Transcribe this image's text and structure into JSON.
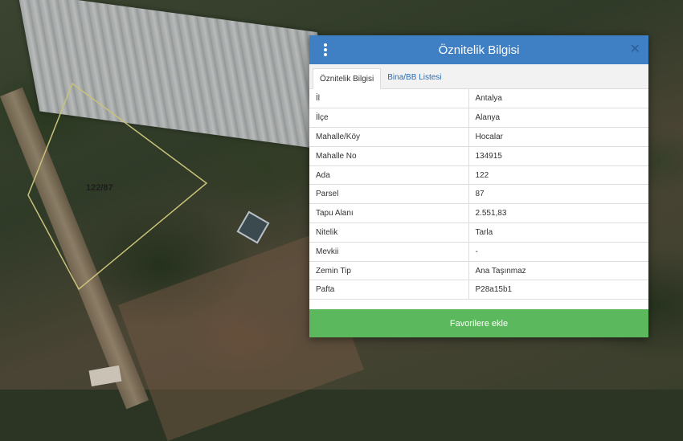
{
  "map": {
    "parcel_label": "122/87"
  },
  "dialog": {
    "title": "Öznitelik Bilgisi",
    "close_symbol": "✕",
    "tabs": [
      {
        "label": "Öznitelik Bilgisi",
        "active": true
      },
      {
        "label": "Bina/BB Listesi",
        "active": false
      }
    ],
    "rows": [
      {
        "key": "İl",
        "value": "Antalya"
      },
      {
        "key": "İlçe",
        "value": "Alanya"
      },
      {
        "key": "Mahalle/Köy",
        "value": "Hocalar"
      },
      {
        "key": "Mahalle No",
        "value": "134915"
      },
      {
        "key": "Ada",
        "value": "122"
      },
      {
        "key": "Parsel",
        "value": "87"
      },
      {
        "key": "Tapu Alanı",
        "value": "2.551,83"
      },
      {
        "key": "Nitelik",
        "value": "Tarla"
      },
      {
        "key": "Mevkii",
        "value": "-"
      },
      {
        "key": "Zemin Tip",
        "value": "Ana Taşınmaz"
      },
      {
        "key": "Pafta",
        "value": "P28a15b1"
      }
    ],
    "favorite_button_label": "Favorilere ekle"
  },
  "colors": {
    "header": "#3f7fc4",
    "button": "#5cb85c",
    "parcel_outline": "#c9c27a"
  },
  "icons": {
    "menu": "vertical-ellipsis-icon",
    "close": "close-icon"
  }
}
